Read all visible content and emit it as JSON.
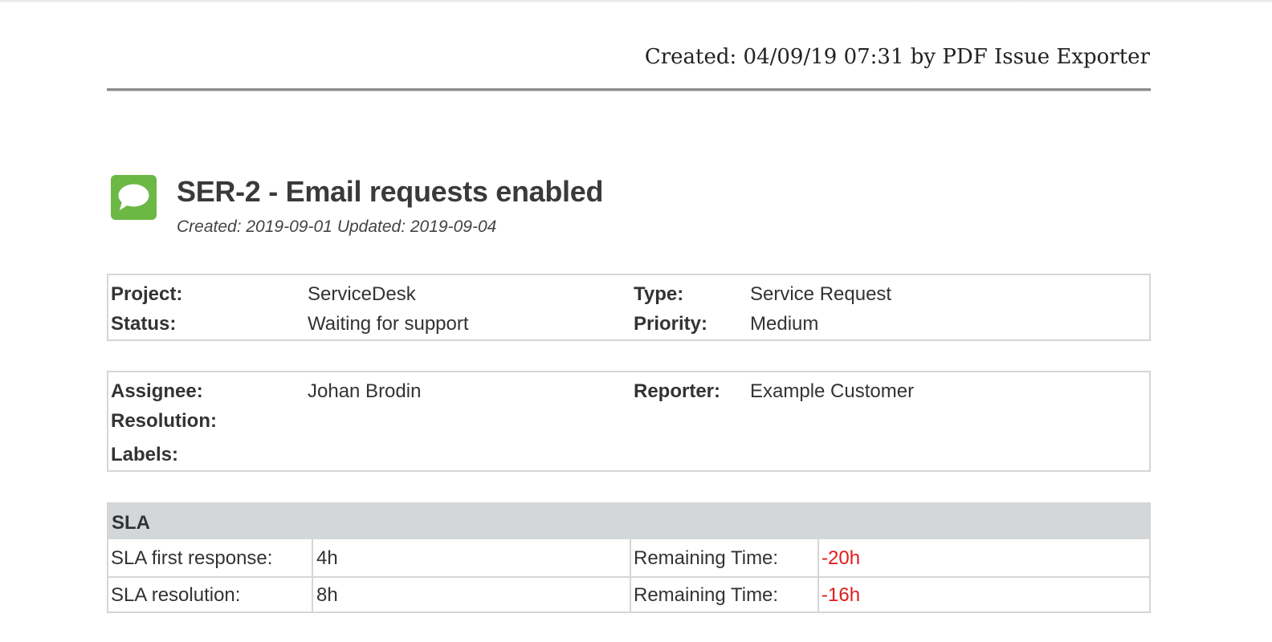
{
  "export_header": "Created: 04/09/19 07:31 by PDF Issue Exporter",
  "issue": {
    "icon": "speech-bubble-icon",
    "icon_color": "#6cb845",
    "title": "SER-2 - Email requests enabled",
    "created": "Created: 2019-09-01",
    "updated": "Updated: 2019-09-04"
  },
  "details": {
    "project_label": "Project:",
    "project_value": "ServiceDesk",
    "type_label": "Type:",
    "type_value": "Service Request",
    "status_label": "Status:",
    "status_value": "Waiting for support",
    "priority_label": "Priority:",
    "priority_value": "Medium"
  },
  "people": {
    "assignee_label": "Assignee:",
    "assignee_value": "Johan Brodin",
    "reporter_label": "Reporter:",
    "reporter_value": "Example Customer",
    "resolution_label": "Resolution:",
    "labels_label": "Labels:"
  },
  "sla": {
    "heading": "SLA",
    "rows": [
      {
        "name": "SLA first response:",
        "target": "4h",
        "remaining_label": "Remaining Time:",
        "remaining": "-20h"
      },
      {
        "name": "SLA resolution:",
        "target": "8h",
        "remaining_label": "Remaining Time:",
        "remaining": "-16h"
      }
    ],
    "negative_color": "#e01b1b"
  }
}
